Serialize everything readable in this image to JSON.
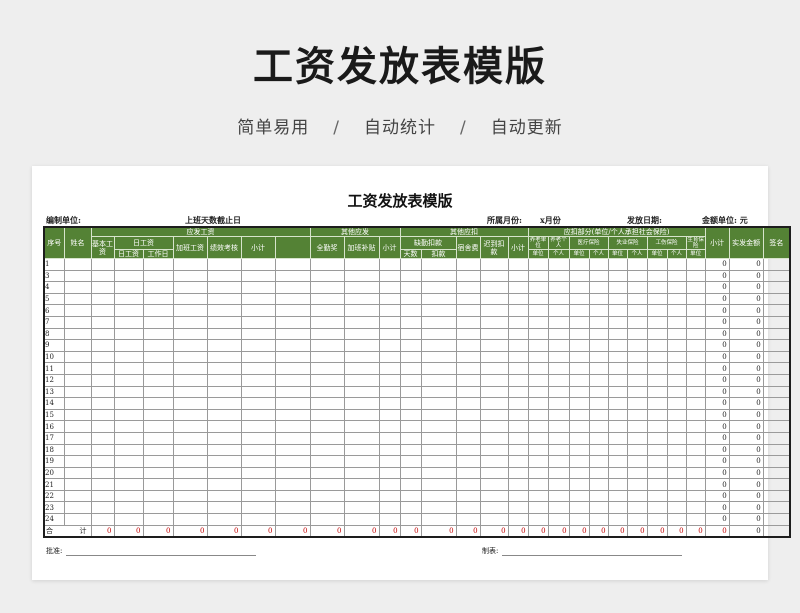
{
  "hero": {
    "title": "工资发放表模版",
    "tags": [
      "简单易用",
      "自动统计",
      "自动更新"
    ],
    "separator": "/"
  },
  "doc": {
    "title": "工资发放表模版",
    "meta": {
      "unit_label": "编制单位:",
      "cutoff_label": "上班天数截止日",
      "month_label": "所属月份:",
      "month_value": "x月份",
      "pay_date_label": "发放日期:",
      "amount_unit_label": "金额单位: 元"
    },
    "headers": {
      "seq": "序号",
      "name": "姓名",
      "should_pay": "应发工资",
      "base": "基本工资",
      "daily_group": "日工资",
      "daily_wage": "日工资",
      "work_days": "工作日",
      "overtime": "加班工资",
      "performance": "绩效考核",
      "subtotal": "小计",
      "other_pay": "其他应发",
      "attendance_bonus": "全勤奖",
      "overtime_allowance": "加班补贴",
      "other_deduct": "其他应扣",
      "absence_group": "缺勤扣款",
      "days": "天数",
      "deduction": "扣款",
      "dorm_fee": "宿舍费",
      "late_deduct": "迟到扣款",
      "insurance_group": "应扣部分(单位/个人承担社会保险)",
      "pension_unit": "养老单位",
      "pension_person": "养老个人",
      "medical_group": "医疗保险",
      "unemploy_group": "失业保险",
      "injury": "工伤保险",
      "maternity": "生育保险",
      "unit": "单位",
      "person": "个人",
      "total": "小计",
      "net_pay": "实发金额",
      "signature": "签名"
    },
    "rows": [
      {
        "seq": "1",
        "subtotal": "0",
        "net": "0"
      },
      {
        "seq": "3",
        "subtotal": "0",
        "net": "0"
      },
      {
        "seq": "4",
        "subtotal": "0",
        "net": "0"
      },
      {
        "seq": "5",
        "subtotal": "0",
        "net": "0"
      },
      {
        "seq": "6",
        "subtotal": "0",
        "net": "0"
      },
      {
        "seq": "7",
        "subtotal": "0",
        "net": "0"
      },
      {
        "seq": "8",
        "subtotal": "0",
        "net": "0"
      },
      {
        "seq": "9",
        "subtotal": "0",
        "net": "0"
      },
      {
        "seq": "10",
        "subtotal": "0",
        "net": "0"
      },
      {
        "seq": "11",
        "subtotal": "0",
        "net": "0"
      },
      {
        "seq": "12",
        "subtotal": "0",
        "net": "0"
      },
      {
        "seq": "13",
        "subtotal": "0",
        "net": "0"
      },
      {
        "seq": "14",
        "subtotal": "0",
        "net": "0"
      },
      {
        "seq": "15",
        "subtotal": "0",
        "net": "0"
      },
      {
        "seq": "16",
        "subtotal": "0",
        "net": "0"
      },
      {
        "seq": "17",
        "subtotal": "0",
        "net": "0"
      },
      {
        "seq": "18",
        "subtotal": "0",
        "net": "0"
      },
      {
        "seq": "19",
        "subtotal": "0",
        "net": "0"
      },
      {
        "seq": "20",
        "subtotal": "0",
        "net": "0"
      },
      {
        "seq": "21",
        "subtotal": "0",
        "net": "0"
      },
      {
        "seq": "22",
        "subtotal": "0",
        "net": "0"
      },
      {
        "seq": "23",
        "subtotal": "0",
        "net": "0"
      },
      {
        "seq": "24",
        "subtotal": "0",
        "net": "0"
      }
    ],
    "totals": {
      "label_left": "合",
      "label_right": "计",
      "values": [
        "0",
        "0",
        "0",
        "0",
        "0",
        "0",
        "0",
        "0",
        "0",
        "0",
        "0",
        "0",
        "0",
        "0",
        "0",
        "0",
        "0",
        "0",
        "0",
        "0",
        "0",
        "0",
        "0",
        "0",
        "0",
        "0"
      ]
    },
    "footer": {
      "approve_label": "批准:",
      "prepare_label": "制表:"
    }
  },
  "colors": {
    "header_green": "#548235",
    "total_red": "#c00000"
  }
}
